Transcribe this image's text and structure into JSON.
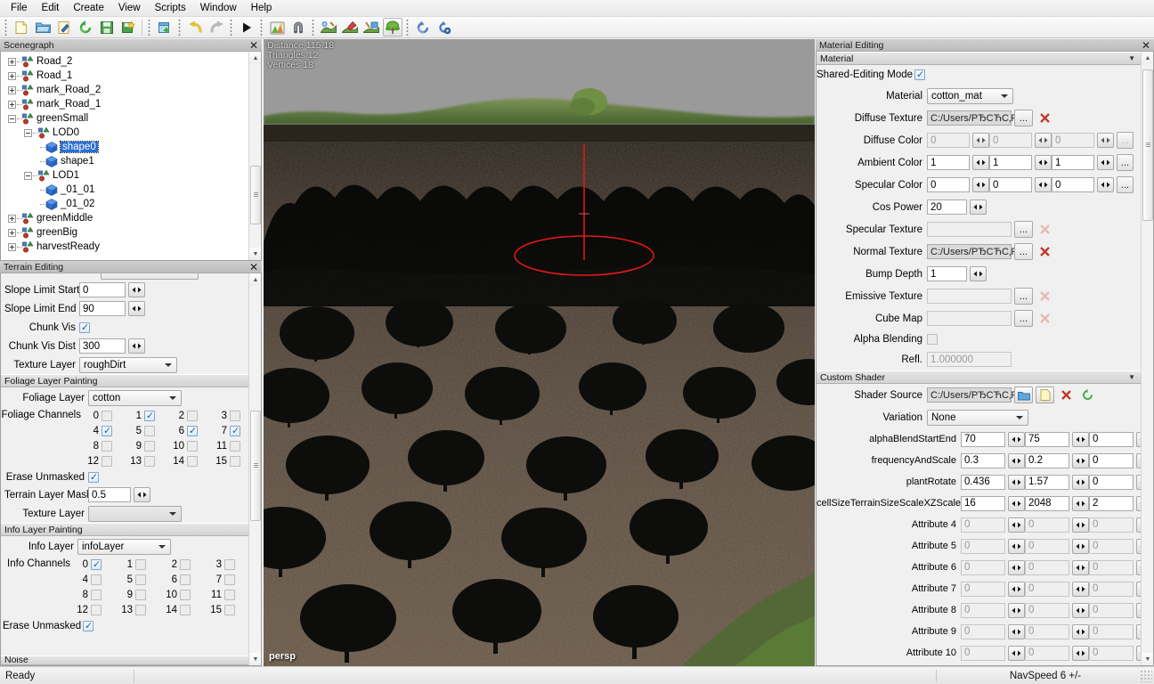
{
  "menu": {
    "items": [
      "File",
      "Edit",
      "Create",
      "View",
      "Scripts",
      "Window",
      "Help"
    ]
  },
  "toolbar": {
    "groups": [
      {
        "buttons": [
          {
            "name": "new-file-icon",
            "label": "New"
          },
          {
            "name": "open-folder-icon",
            "label": "Open"
          },
          {
            "name": "edit-document-icon",
            "label": "Edit"
          },
          {
            "name": "refresh-icon",
            "label": "Refresh"
          },
          {
            "name": "save-icon",
            "label": "Save"
          },
          {
            "name": "save-as-icon",
            "label": "Save As"
          }
        ]
      },
      {
        "buttons": [
          {
            "name": "new-window-icon",
            "label": "New Window"
          }
        ]
      },
      {
        "buttons": [
          {
            "name": "undo-icon",
            "label": "Undo"
          },
          {
            "name": "redo-icon",
            "label": "Redo"
          }
        ]
      },
      {
        "buttons": [
          {
            "name": "play-icon",
            "label": "Play"
          }
        ]
      },
      {
        "buttons": [
          {
            "name": "home-scene-icon",
            "label": "Home"
          },
          {
            "name": "magnet-icon",
            "label": "Snap"
          }
        ]
      },
      {
        "buttons": [
          {
            "name": "terrain-sculpt-icon",
            "label": "Sculpt Terrain"
          },
          {
            "name": "terrain-paint-icon",
            "label": "Paint Terrain"
          },
          {
            "name": "terrain-texture-icon",
            "label": "Texture Terrain"
          },
          {
            "name": "foliage-paint-icon",
            "label": "Paint Foliage",
            "active": true
          }
        ]
      },
      {
        "buttons": [
          {
            "name": "recycle-icon",
            "label": "Regenerate"
          },
          {
            "name": "settings-refresh-icon",
            "label": "Rebuild"
          }
        ]
      }
    ]
  },
  "scenegraph": {
    "title": "Scenegraph",
    "close_label": "✕",
    "nodes": [
      {
        "label": "Road_2",
        "depth": 0,
        "expander": "plus",
        "icon": "transform-node-icon"
      },
      {
        "label": "Road_1",
        "depth": 0,
        "expander": "plus",
        "icon": "transform-node-icon"
      },
      {
        "label": "mark_Road_2",
        "depth": 0,
        "expander": "plus",
        "icon": "transform-node-icon"
      },
      {
        "label": "mark_Road_1",
        "depth": 0,
        "expander": "plus",
        "icon": "transform-node-icon"
      },
      {
        "label": "greenSmall",
        "depth": 0,
        "expander": "minus",
        "icon": "transform-node-icon"
      },
      {
        "label": "LOD0",
        "depth": 1,
        "expander": "minus",
        "icon": "transform-node-icon"
      },
      {
        "label": "shape0",
        "depth": 2,
        "expander": "none",
        "icon": "mesh-shape-icon",
        "selected": true
      },
      {
        "label": "shape1",
        "depth": 2,
        "expander": "none",
        "icon": "mesh-shape-icon"
      },
      {
        "label": "LOD1",
        "depth": 1,
        "expander": "minus",
        "icon": "transform-node-icon"
      },
      {
        "label": "_01_01",
        "depth": 2,
        "expander": "none",
        "icon": "mesh-shape-icon"
      },
      {
        "label": "_01_02",
        "depth": 2,
        "expander": "none",
        "icon": "mesh-shape-icon"
      },
      {
        "label": "greenMiddle",
        "depth": 0,
        "expander": "plus",
        "icon": "transform-node-icon"
      },
      {
        "label": "greenBig",
        "depth": 0,
        "expander": "plus",
        "icon": "transform-node-icon"
      },
      {
        "label": "harvestReady",
        "depth": 0,
        "expander": "plus",
        "icon": "transform-node-icon"
      }
    ]
  },
  "terrain": {
    "title": "Terrain Editing",
    "close_label": "✕",
    "slope_limit_start_label": "Slope Limit Start",
    "slope_limit_start_value": "0",
    "slope_limit_end_label": "Slope Limit End",
    "slope_limit_end_value": "90",
    "chunk_vis_label": "Chunk Vis",
    "chunk_vis_checked": true,
    "chunk_vis_dist_label": "Chunk Vis Dist",
    "chunk_vis_dist_value": "300",
    "texture_layer_label": "Texture Layer",
    "texture_layer_value": "roughDirt"
  },
  "foliage": {
    "section_title": "Foliage Layer Painting",
    "layer_label": "Foliage Layer",
    "layer_value": "cotton",
    "channels_label": "Foliage Channels",
    "channels": [
      {
        "num": "0",
        "checked": false
      },
      {
        "num": "1",
        "checked": true
      },
      {
        "num": "2",
        "checked": false
      },
      {
        "num": "3",
        "checked": false
      },
      {
        "num": "4",
        "checked": true
      },
      {
        "num": "5",
        "checked": false
      },
      {
        "num": "6",
        "checked": true
      },
      {
        "num": "7",
        "checked": true
      },
      {
        "num": "8",
        "checked": false
      },
      {
        "num": "9",
        "checked": false
      },
      {
        "num": "10",
        "checked": false
      },
      {
        "num": "11",
        "checked": false
      },
      {
        "num": "12",
        "checked": false
      },
      {
        "num": "13",
        "checked": false
      },
      {
        "num": "14",
        "checked": false
      },
      {
        "num": "15",
        "checked": false
      }
    ],
    "erase_unmasked_label": "Erase Unmasked",
    "erase_unmasked_checked": true,
    "terrain_layer_mask_label": "Terrain Layer Mask",
    "terrain_layer_mask_value": "0.5",
    "texture_layer_label": "Texture Layer",
    "texture_layer_value": ""
  },
  "info_layer": {
    "section_title": "Info Layer Painting",
    "layer_label": "Info Layer",
    "layer_value": "infoLayer",
    "channels_label": "Info Channels",
    "channels": [
      {
        "num": "0",
        "checked": true
      },
      {
        "num": "1",
        "checked": false
      },
      {
        "num": "2",
        "checked": false
      },
      {
        "num": "3",
        "checked": false
      },
      {
        "num": "4",
        "checked": false
      },
      {
        "num": "5",
        "checked": false
      },
      {
        "num": "6",
        "checked": false
      },
      {
        "num": "7",
        "checked": false
      },
      {
        "num": "8",
        "checked": false
      },
      {
        "num": "9",
        "checked": false
      },
      {
        "num": "10",
        "checked": false
      },
      {
        "num": "11",
        "checked": false
      },
      {
        "num": "12",
        "checked": false
      },
      {
        "num": "13",
        "checked": false
      },
      {
        "num": "14",
        "checked": false
      },
      {
        "num": "15",
        "checked": false
      }
    ],
    "erase_unmasked_label": "Erase Unmasked",
    "erase_unmasked_checked": true
  },
  "noise": {
    "section_title": "Noise"
  },
  "viewport": {
    "overlay_line1": "Distance 115.18",
    "overlay_line2": "Triangles 12",
    "overlay_line3": "Vertices 18",
    "persp_label": "persp",
    "brush_color": "#e01818",
    "sky_color": "#9a9a9a",
    "hill_color": "#5f7a3e",
    "soil_color": "#3d3328"
  },
  "material": {
    "title": "Material Editing",
    "close_label": "✕",
    "section_title": "Material",
    "shared_editing_label": "Shared-Editing Mode",
    "shared_editing_checked": true,
    "material_label": "Material",
    "material_value": "cotton_mat",
    "diffuse_texture_label": "Diffuse Texture",
    "diffuse_texture_value": "C:/Users/PЂCЋC‚Pļ",
    "diffuse_color_label": "Diffuse Color",
    "diffuse_color": [
      "0",
      "0",
      "0"
    ],
    "ambient_color_label": "Ambient Color",
    "ambient_color": [
      "1",
      "1",
      "1"
    ],
    "specular_color_label": "Specular Color",
    "specular_color": [
      "0",
      "0",
      "0"
    ],
    "cos_power_label": "Cos Power",
    "cos_power_value": "20",
    "specular_texture_label": "Specular Texture",
    "specular_texture_value": "",
    "normal_texture_label": "Normal Texture",
    "normal_texture_value": "C:/Users/PЂCЋC‚Pļ",
    "bump_depth_label": "Bump Depth",
    "bump_depth_value": "1",
    "emissive_texture_label": "Emissive Texture",
    "emissive_texture_value": "",
    "cube_map_label": "Cube Map",
    "cube_map_value": "",
    "alpha_blending_label": "Alpha Blending",
    "alpha_blending_checked": false,
    "refl_label": "Refl.",
    "refl_value": "1.000000",
    "browse_label": "...",
    "clear_label": "✕"
  },
  "shader": {
    "section_title": "Custom Shader",
    "source_label": "Shader Source",
    "source_value": "C:/Users/PЂCЋC‚Pļ",
    "variation_label": "Variation",
    "variation_value": "None",
    "params": [
      {
        "label": "alphaBlendStartEnd",
        "values": [
          "70",
          "75",
          "0"
        ],
        "enabled": true
      },
      {
        "label": "frequencyAndScale",
        "values": [
          "0.3",
          "0.2",
          "0"
        ],
        "enabled": true
      },
      {
        "label": "plantRotate",
        "values": [
          "0.436",
          "1.57",
          "0"
        ],
        "enabled": true
      },
      {
        "label": "cellSizeTerrainSizeScaleXZScaleY",
        "values": [
          "16",
          "2048",
          "2"
        ],
        "enabled": true
      },
      {
        "label": "Attribute 4",
        "values": [
          "0",
          "0",
          "0"
        ],
        "enabled": false
      },
      {
        "label": "Attribute 5",
        "values": [
          "0",
          "0",
          "0"
        ],
        "enabled": false
      },
      {
        "label": "Attribute 6",
        "values": [
          "0",
          "0",
          "0"
        ],
        "enabled": false
      },
      {
        "label": "Attribute 7",
        "values": [
          "0",
          "0",
          "0"
        ],
        "enabled": false
      },
      {
        "label": "Attribute 8",
        "values": [
          "0",
          "0",
          "0"
        ],
        "enabled": false
      },
      {
        "label": "Attribute 9",
        "values": [
          "0",
          "0",
          "0"
        ],
        "enabled": false
      },
      {
        "label": "Attribute 10",
        "values": [
          "0",
          "0",
          "0"
        ],
        "enabled": false
      }
    ],
    "open_label": "open-shader-icon",
    "new_label": "new-shader-icon",
    "delete_label": "✕",
    "reload_label": "⟳"
  },
  "statusbar": {
    "ready_label": "Ready",
    "navspeed_label": "NavSpeed 6 +/-"
  }
}
